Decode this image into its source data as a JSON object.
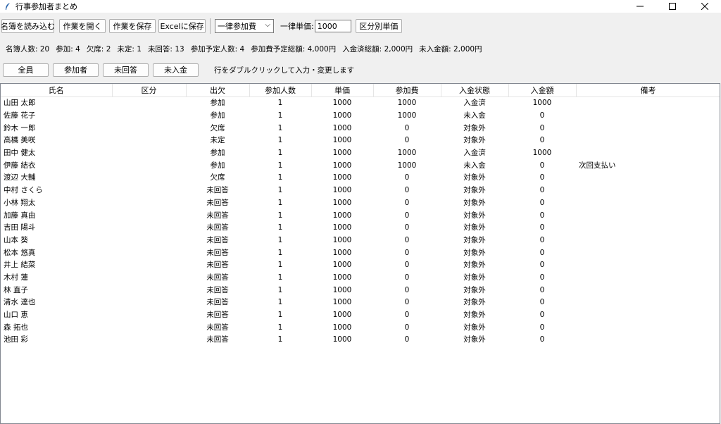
{
  "window": {
    "title": "行事参加者まとめ",
    "icon": "feather-icon"
  },
  "toolbar": {
    "load_roster": "名簿を読み込む",
    "open_work": "作業を開く",
    "save_work": "作業を保存",
    "save_excel": "Excelに保存",
    "fee_mode": "一律参加費",
    "unit_price_label": "一律単価:",
    "unit_price_value": "1000",
    "category_price": "区分別単価"
  },
  "stats": {
    "roster_count": "名簿人数: 20",
    "attend": "参加: 4",
    "absent": "欠席: 2",
    "undecided": "未定: 1",
    "no_answer": "未回答: 13",
    "planned_people": "参加予定人数: 4",
    "planned_fee_total": "参加費予定総額: 4,000円",
    "paid_total": "入金済総額: 2,000円",
    "unpaid_total": "未入金額: 2,000円"
  },
  "filters": {
    "all": "全員",
    "attendees": "参加者",
    "no_answer": "未回答",
    "unpaid": "未入金",
    "hint": "行をダブルクリックして入力・変更します"
  },
  "table": {
    "columns": [
      "氏名",
      "区分",
      "出欠",
      "参加人数",
      "単価",
      "参加費",
      "入金状態",
      "入金額",
      "備考"
    ],
    "rows": [
      [
        "山田 太郎",
        "",
        "参加",
        "1",
        "1000",
        "1000",
        "入金済",
        "1000",
        ""
      ],
      [
        "佐藤 花子",
        "",
        "参加",
        "1",
        "1000",
        "1000",
        "未入金",
        "0",
        ""
      ],
      [
        "鈴木 一郎",
        "",
        "欠席",
        "1",
        "1000",
        "0",
        "対象外",
        "0",
        ""
      ],
      [
        "高橋 美咲",
        "",
        "未定",
        "1",
        "1000",
        "0",
        "対象外",
        "0",
        ""
      ],
      [
        "田中 健太",
        "",
        "参加",
        "1",
        "1000",
        "1000",
        "入金済",
        "1000",
        ""
      ],
      [
        "伊藤 結衣",
        "",
        "参加",
        "1",
        "1000",
        "1000",
        "未入金",
        "0",
        "次回支払い"
      ],
      [
        "渡辺 大輔",
        "",
        "欠席",
        "1",
        "1000",
        "0",
        "対象外",
        "0",
        ""
      ],
      [
        "中村 さくら",
        "",
        "未回答",
        "1",
        "1000",
        "0",
        "対象外",
        "0",
        ""
      ],
      [
        "小林 翔太",
        "",
        "未回答",
        "1",
        "1000",
        "0",
        "対象外",
        "0",
        ""
      ],
      [
        "加藤 真由",
        "",
        "未回答",
        "1",
        "1000",
        "0",
        "対象外",
        "0",
        ""
      ],
      [
        "吉田 陽斗",
        "",
        "未回答",
        "1",
        "1000",
        "0",
        "対象外",
        "0",
        ""
      ],
      [
        "山本 葵",
        "",
        "未回答",
        "1",
        "1000",
        "0",
        "対象外",
        "0",
        ""
      ],
      [
        "松本 悠真",
        "",
        "未回答",
        "1",
        "1000",
        "0",
        "対象外",
        "0",
        ""
      ],
      [
        "井上 結菜",
        "",
        "未回答",
        "1",
        "1000",
        "0",
        "対象外",
        "0",
        ""
      ],
      [
        "木村 蓮",
        "",
        "未回答",
        "1",
        "1000",
        "0",
        "対象外",
        "0",
        ""
      ],
      [
        "林 直子",
        "",
        "未回答",
        "1",
        "1000",
        "0",
        "対象外",
        "0",
        ""
      ],
      [
        "清水 達也",
        "",
        "未回答",
        "1",
        "1000",
        "0",
        "対象外",
        "0",
        ""
      ],
      [
        "山口 恵",
        "",
        "未回答",
        "1",
        "1000",
        "0",
        "対象外",
        "0",
        ""
      ],
      [
        "森 拓也",
        "",
        "未回答",
        "1",
        "1000",
        "0",
        "対象外",
        "0",
        ""
      ],
      [
        "池田 彩",
        "",
        "未回答",
        "1",
        "1000",
        "0",
        "対象外",
        "0",
        ""
      ]
    ]
  }
}
